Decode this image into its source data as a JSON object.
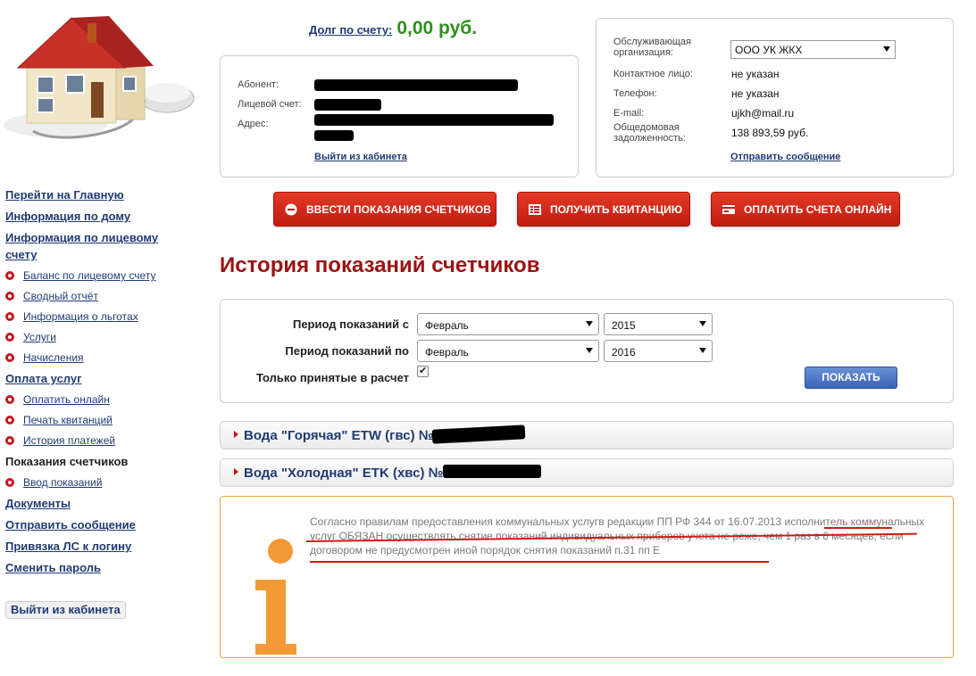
{
  "header": {
    "debt_label": "Долг по счету:",
    "debt_value": "0,00 руб."
  },
  "account": {
    "abonent_label": "Абонент:",
    "account_label": "Лицевой счет:",
    "address_label": "Адрес:",
    "logout_link": "Выйти из кабинета"
  },
  "organization": {
    "org_label": "Обслуживающая организация:",
    "org_selected": "ООО УК ЖКХ",
    "contact_label": "Контактное лицо:",
    "contact_value": "не указан",
    "phone_label": "Телефон:",
    "phone_value": "не указан",
    "email_label": "E-mail:",
    "email_value": "ujkh@mail.ru",
    "house_debt_label": "Общедомовая задолженность:",
    "house_debt_value": "138 893,59 руб.",
    "send_message_link": "Отправить сообщение"
  },
  "actions": {
    "enter_readings": "ВВЕСТИ ПОКАЗАНИЯ СЧЕТЧИКОВ",
    "get_receipt": "ПОЛУЧИТЬ КВИТАНЦИЮ",
    "pay_online": "ОПЛАТИТЬ СЧЕТА ОНЛАЙН"
  },
  "sidebar": {
    "home": "Перейти на Главную",
    "house_info": "Информация по дому",
    "account_info": "Информация по лицевому счету",
    "account_items": [
      "Баланс по лицевому счету",
      "Сводный отчёт",
      "Информация о льготах",
      "Услуги",
      "Начисления"
    ],
    "payment": "Оплата услуг",
    "payment_items": [
      "Оплатить онлайн",
      "Печать квитанций",
      "История платежей"
    ],
    "meter_readings": "Показания счетчиков",
    "meter_items": [
      "Ввод показаний"
    ],
    "documents": "Документы",
    "send_message": "Отправить сообщение",
    "bind_login": "Привязка ЛС к логину",
    "change_password": "Сменить пароль",
    "logout": "Выйти из кабинета"
  },
  "main": {
    "title": "История показаний счетчиков",
    "filter": {
      "period_from_label": "Период показаний с",
      "period_to_label": "Период показаний по",
      "from_month": "Февраль",
      "from_year": "2015",
      "to_month": "Февраль",
      "to_year": "2016",
      "accepted_only_label": "Только принятые в расчет",
      "accepted_only_checked": true,
      "show_button": "ПОКАЗАТЬ"
    },
    "meters": [
      {
        "title": "Вода \"Горячая\" ETW (гвс) №"
      },
      {
        "title": "Вода \"Холодная\" ETK (хвс) №"
      }
    ],
    "info": {
      "text": "Согласно правилам предоставления коммунальных услугв редакции ПП РФ 344 от 16.07.2013 исполнитель коммунальных услуг ОБЯЗАН осуществлять снятие показаний индивидуальных приборов учета не реже, чем 1 раз в 6 месяцев, если договором не предусмотрен иной порядок снятия показаний п.31 пп Е"
    }
  },
  "colors": {
    "accent_red": "#c4171f",
    "title_red": "#9c1212",
    "link_blue": "#1f3b73",
    "debt_green": "#2f8f1f",
    "info_orange": "#f29a36"
  }
}
